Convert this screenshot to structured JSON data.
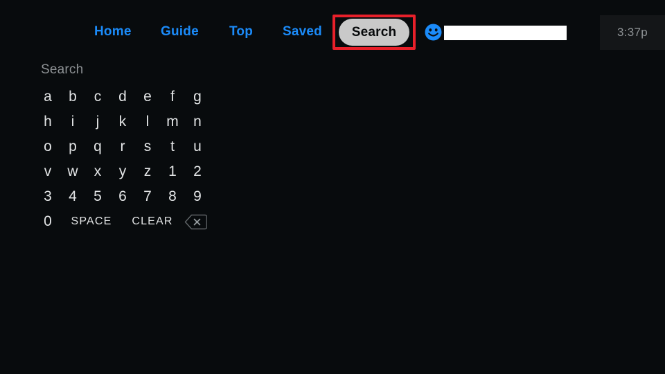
{
  "app": {
    "background_color": "#080b0d",
    "accent_color": "#1b8bf9",
    "highlight_color": "#e8202a"
  },
  "topbar": {
    "nav_items": [
      {
        "id": "home",
        "label": "Home"
      },
      {
        "id": "guide",
        "label": "Guide"
      },
      {
        "id": "top",
        "label": "Top"
      },
      {
        "id": "saved",
        "label": "Saved"
      }
    ],
    "search_button": {
      "label": "Search",
      "selected": true,
      "highlight_color": "#e8202a",
      "pill_color": "#c9c9c9",
      "text_color": "#07090b"
    },
    "avatar": {
      "icon": "smiley-face-icon",
      "color": "#1b8bf9"
    },
    "search_input": {
      "value": "",
      "placeholder": "",
      "background_color": "#ffffff"
    },
    "clock": {
      "time": "3:37p",
      "text_color": "#8e9295",
      "background_color": "#141618"
    }
  },
  "keyboard": {
    "title": "Search",
    "rows": [
      {
        "keys": [
          "a",
          "b",
          "c",
          "d",
          "e",
          "f",
          "g"
        ]
      },
      {
        "keys": [
          "h",
          "i",
          "j",
          "k",
          "l",
          "m",
          "n"
        ]
      },
      {
        "keys": [
          "o",
          "p",
          "q",
          "r",
          "s",
          "t",
          "u"
        ]
      },
      {
        "keys": [
          "v",
          "w",
          "x",
          "y",
          "z",
          "1",
          "2"
        ]
      },
      {
        "keys": [
          "3",
          "4",
          "5",
          "6",
          "7",
          "8",
          "9"
        ]
      }
    ],
    "last_row": {
      "zero": "0",
      "space": "SPACE",
      "clear": "CLEAR",
      "backspace_icon": "backspace-icon"
    },
    "text_color": "#e3e5e6"
  }
}
